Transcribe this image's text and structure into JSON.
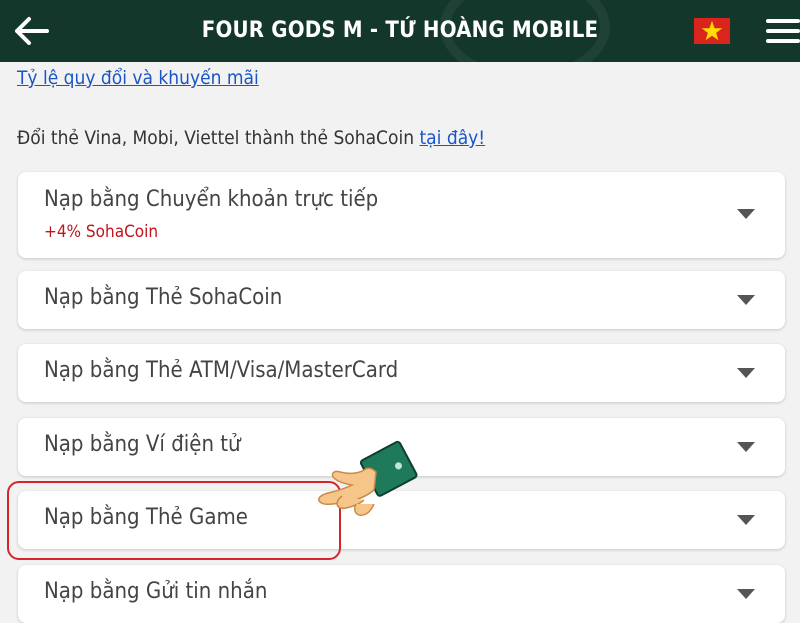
{
  "header": {
    "title": "FOUR GODS M - TỨ HOÀNG MOBILE",
    "back_icon": "arrow-left-icon",
    "flag_icon": "vietnam-flag-icon",
    "menu_icon": "hamburger-menu-icon"
  },
  "content": {
    "rate_link": "Tỷ lệ quy đổi và khuyến mãi",
    "exchange_text": "Đổi thẻ Vina, Mobi, Viettel thành thẻ SohaCoin",
    "exchange_link": "tại đây!"
  },
  "options": [
    {
      "label": "Nạp bằng Chuyển khoản trực tiếp",
      "sub": "+4% SohaCoin"
    },
    {
      "label": "Nạp bằng Thẻ SohaCoin"
    },
    {
      "label": "Nạp bằng Thẻ ATM/Visa/MasterCard"
    },
    {
      "label": "Nạp bằng Ví điện tử"
    },
    {
      "label": "Nạp bằng Thẻ Game"
    },
    {
      "label": "Nạp bằng Gửi tin nhắn"
    }
  ],
  "colors": {
    "header_bg": "#14372c",
    "link": "#1a55c8",
    "bonus_text": "#c0141b",
    "highlight_border": "#d8232a",
    "hand_cuff": "#1f7a5c"
  },
  "annotation_icon": "pointing-hand-icon"
}
